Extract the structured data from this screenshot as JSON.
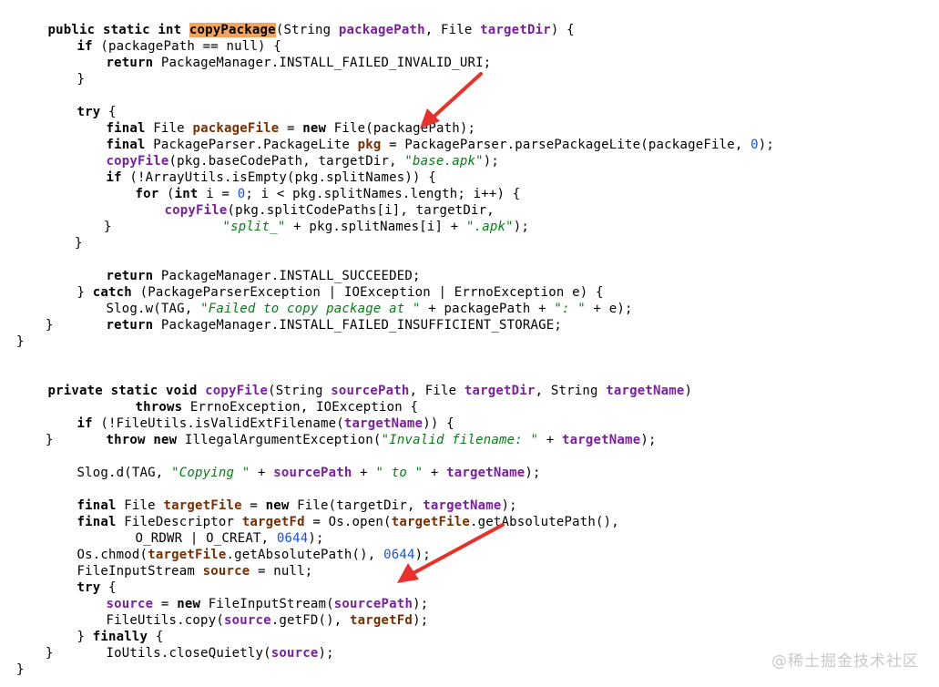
{
  "code": {
    "l1": [
      "public",
      " ",
      "static",
      " ",
      "int",
      " ",
      "copyPackage",
      "(String ",
      "packagePath",
      ", File ",
      "targetDir",
      ") {"
    ],
    "l2": [
      "if",
      " (packagePath == null) {"
    ],
    "l3": [
      "return",
      " PackageManager.INSTALL_FAILED_INVALID_URI;"
    ],
    "l4": [
      "}"
    ],
    "l6": [
      "try",
      " {"
    ],
    "l7": [
      "final",
      " File ",
      "packageFile",
      " = ",
      "new",
      " File(packagePath);"
    ],
    "l8": [
      "final",
      " PackageParser.PackageLite ",
      "pkg",
      " = PackageParser.parsePackageLite(packageFile, ",
      "0",
      ");"
    ],
    "l9": [
      "copyFile",
      "(pkg.baseCodePath, targetDir, ",
      "\"base.apk\"",
      ");"
    ],
    "l10": [
      "if",
      " (!ArrayUtils.isEmpty(pkg.splitNames)) {"
    ],
    "l11": [
      "for",
      " (",
      "int",
      " i = ",
      "0",
      "; i < pkg.splitNames.length; i++) {"
    ],
    "l12": [
      "copyFile",
      "(pkg.splitCodePaths[i], targetDir,"
    ],
    "l13": [
      "\"split_\"",
      " + pkg.splitNames[i] + ",
      "\".apk\"",
      ");"
    ],
    "l14": [
      "}"
    ],
    "l15": [
      "}"
    ],
    "l16": [
      "return",
      " PackageManager.INSTALL_SUCCEEDED;"
    ],
    "l17": [
      "} ",
      "catch",
      " (PackageParserException | IOException | ErrnoException e) {"
    ],
    "l18": [
      "Slog.w(TAG, ",
      "\"Failed to copy package at \"",
      " + packagePath + ",
      "\": \"",
      " + e);"
    ],
    "l19": [
      "return",
      " PackageManager.INSTALL_FAILED_INSUFFICIENT_STORAGE;"
    ],
    "l20": [
      "}"
    ],
    "l21": [
      "}"
    ],
    "l23": [
      "private",
      " ",
      "static",
      " ",
      "void",
      " ",
      "copyFile",
      "(String ",
      "sourcePath",
      ", File ",
      "targetDir",
      ", String ",
      "targetName",
      ")"
    ],
    "l24": [
      "throws",
      " ErrnoException, IOException {"
    ],
    "l25": [
      "if",
      " (!FileUtils.isValidExtFilename(",
      "targetName",
      ")) {"
    ],
    "l26": [
      "throw",
      " ",
      "new",
      " IllegalArgumentException(",
      "\"Invalid filename: \"",
      " + ",
      "targetName",
      ");"
    ],
    "l27": [
      "}"
    ],
    "l28": [
      "Slog.d(TAG, ",
      "\"Copying \"",
      " + ",
      "sourcePath",
      " + ",
      "\" to \"",
      " + ",
      "targetName",
      ");"
    ],
    "l30": [
      "final",
      " File ",
      "targetFile",
      " = ",
      "new",
      " File(targetDir, ",
      "targetName",
      ");"
    ],
    "l31": [
      "final",
      " FileDescriptor ",
      "targetFd",
      " = Os.open(",
      "targetFile",
      ".getAbsolutePath(),"
    ],
    "l32": [
      "O_RDWR | O_CREAT, ",
      "0644",
      ");"
    ],
    "l33": [
      "Os.chmod(",
      "targetFile",
      ".getAbsolutePath(), ",
      "0644",
      ");"
    ],
    "l34": [
      "FileInputStream ",
      "source",
      " = null;"
    ],
    "l35": [
      "try",
      " {"
    ],
    "l36": [
      "source",
      " = ",
      "new",
      " FileInputStream(",
      "sourcePath",
      ");"
    ],
    "l37": [
      "FileUtils.copy(",
      "source",
      ".getFD(), ",
      "targetFd",
      ");"
    ],
    "l38": [
      "} ",
      "finally",
      " {"
    ],
    "l39": [
      "IoUtils.closeQuietly(",
      "source",
      ");"
    ],
    "l40": [
      "}"
    ],
    "l41": [
      "}"
    ]
  },
  "watermark": "@稀土掘金技术社区",
  "colors": {
    "highlight": "#f5a35a",
    "arrow": "#e8312a"
  }
}
